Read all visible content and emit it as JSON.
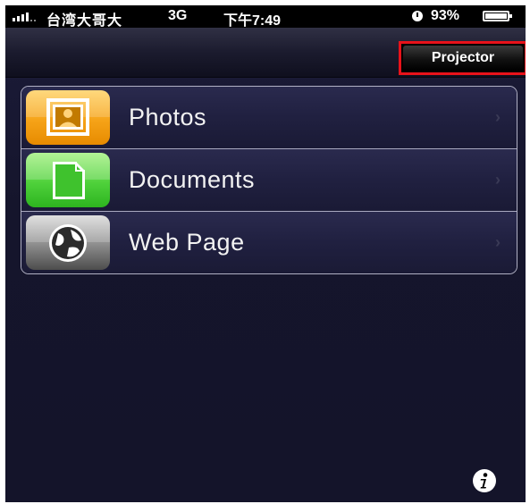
{
  "status_bar": {
    "carrier": "台湾大哥大",
    "network": "3G",
    "time": "下午7:49",
    "battery": "93%",
    "battery_level": 0.93
  },
  "nav_bar": {
    "projector_label": "Projector"
  },
  "menu": {
    "items": [
      {
        "label": "Photos",
        "icon": "photo-frame-icon",
        "color": "#f6a318"
      },
      {
        "label": "Documents",
        "icon": "document-icon",
        "color": "#4fd13b"
      },
      {
        "label": "Web Page",
        "icon": "globe-icon",
        "color": "#8b8b8b"
      }
    ],
    "chevron": "›"
  },
  "footer": {
    "info_icon": "info-icon"
  }
}
